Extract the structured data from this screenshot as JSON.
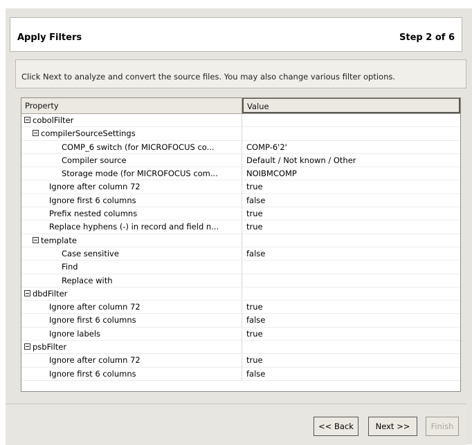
{
  "header": {
    "title": "Apply Filters",
    "step": "Step 2 of 6"
  },
  "instruction": "Click Next to analyze and convert the source files. You may also change various filter options.",
  "table": {
    "columns": {
      "property": "Property",
      "value": "Value"
    },
    "rows": [
      {
        "label": "cobolFilter",
        "value": "",
        "level": 0,
        "group": true
      },
      {
        "label": "compilerSourceSettings",
        "value": "",
        "level": 1,
        "group": true
      },
      {
        "label": "COMP_6 switch (for MICROFOCUS co...",
        "value": "COMP-6'2'",
        "level": 3,
        "group": false
      },
      {
        "label": "Compiler source",
        "value": "Default / Not known / Other",
        "level": 3,
        "group": false
      },
      {
        "label": "Storage mode (for MICROFOCUS com...",
        "value": "NOIBMCOMP",
        "level": 3,
        "group": false
      },
      {
        "label": "Ignore after column 72",
        "value": "true",
        "level": 2,
        "group": false
      },
      {
        "label": "Ignore first 6 columns",
        "value": "false",
        "level": 2,
        "group": false
      },
      {
        "label": "Prefix nested columns",
        "value": "true",
        "level": 2,
        "group": false
      },
      {
        "label": "Replace hyphens (-) in record and field n...",
        "value": "true",
        "level": 2,
        "group": false
      },
      {
        "label": "template",
        "value": "",
        "level": 1,
        "group": true
      },
      {
        "label": "Case sensitive",
        "value": "false",
        "level": 3,
        "group": false
      },
      {
        "label": "Find",
        "value": "",
        "level": 3,
        "group": false
      },
      {
        "label": "Replace with",
        "value": "",
        "level": 3,
        "group": false
      },
      {
        "label": "dbdFilter",
        "value": "",
        "level": 0,
        "group": true
      },
      {
        "label": "Ignore after column 72",
        "value": "true",
        "level": 2,
        "group": false
      },
      {
        "label": "Ignore first 6 columns",
        "value": "false",
        "level": 2,
        "group": false
      },
      {
        "label": "Ignore labels",
        "value": "true",
        "level": 2,
        "group": false
      },
      {
        "label": "psbFilter",
        "value": "",
        "level": 0,
        "group": true
      },
      {
        "label": "Ignore after column 72",
        "value": "true",
        "level": 2,
        "group": false
      },
      {
        "label": "Ignore first 6 columns",
        "value": "false",
        "level": 2,
        "group": false
      }
    ]
  },
  "buttons": {
    "back": "<< Back",
    "next": "Next >>",
    "finish": "Finish"
  }
}
